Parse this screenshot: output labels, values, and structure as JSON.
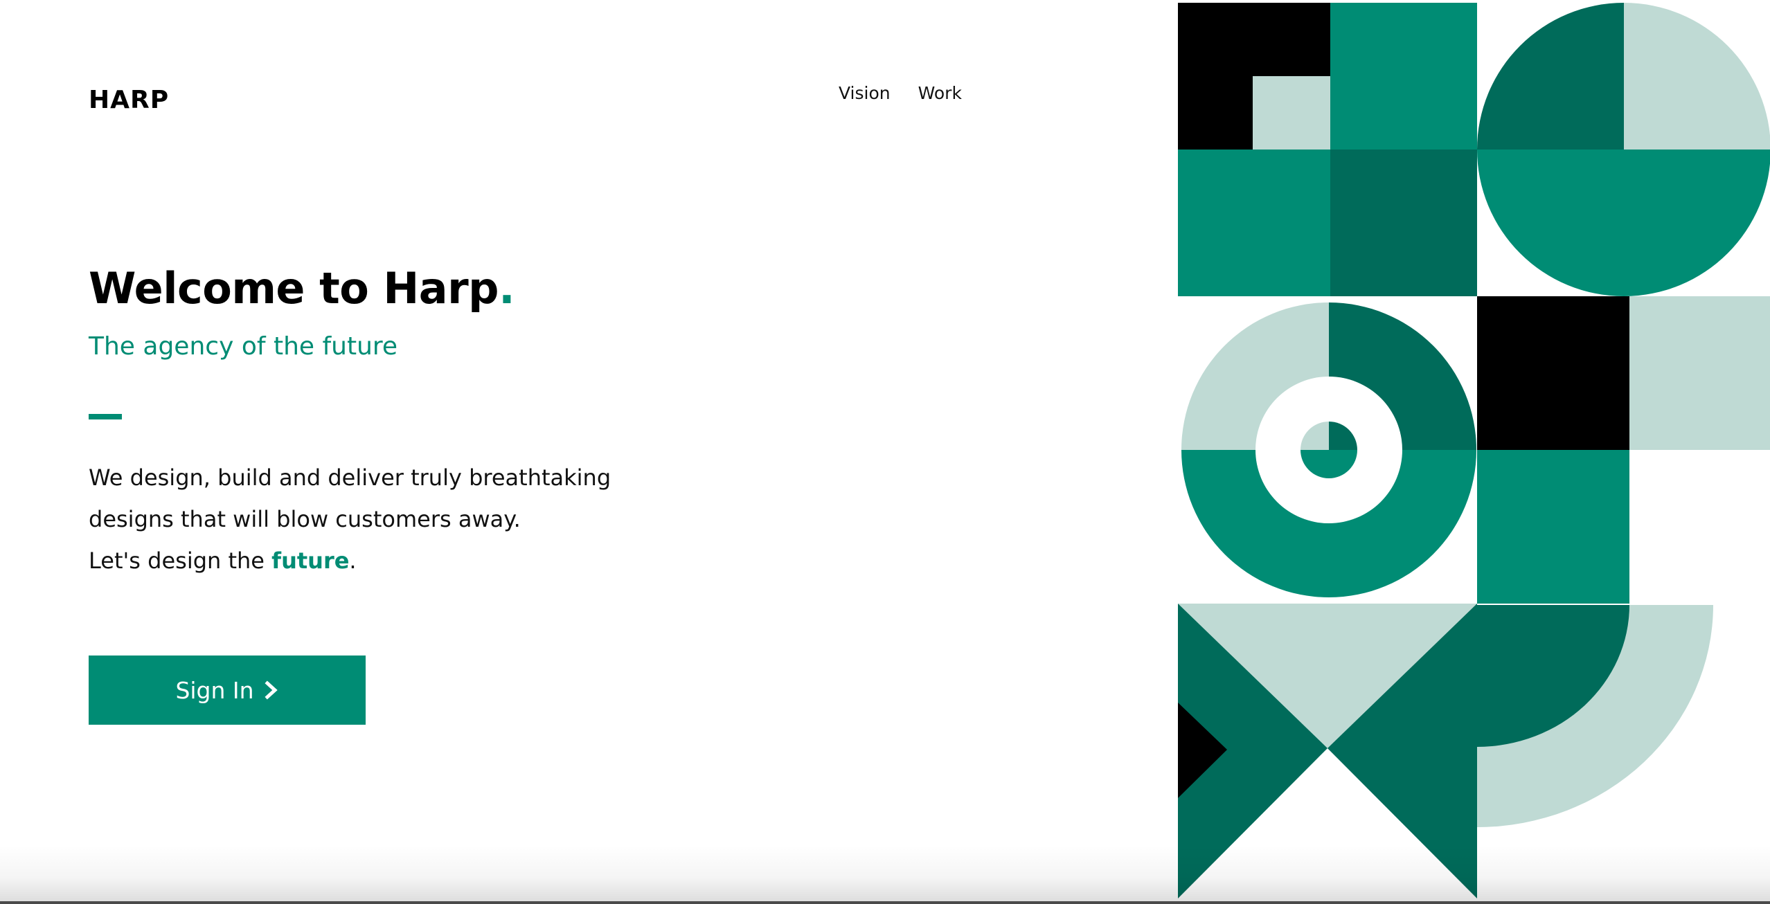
{
  "brand": {
    "logo": "HARP"
  },
  "nav": {
    "items": [
      "Vision",
      "Work"
    ]
  },
  "hero": {
    "title": "Welcome to Harp",
    "title_dot": ".",
    "subtitle": "The agency of the future",
    "body_line1": "We design, build and deliver truly breathtaking",
    "body_line2": "designs that will blow customers away.",
    "body_line3_prefix": "Let's design the ",
    "body_line3_emphasis": "future",
    "body_line3_suffix": ".",
    "cta_label": "Sign In"
  },
  "icons": {
    "cta": "chevron-right-icon"
  },
  "colors": {
    "accent": "#008c74",
    "dark_green": "#006b5a",
    "light_green": "#bfdad4",
    "black": "#000000",
    "background": "#ffffff"
  }
}
